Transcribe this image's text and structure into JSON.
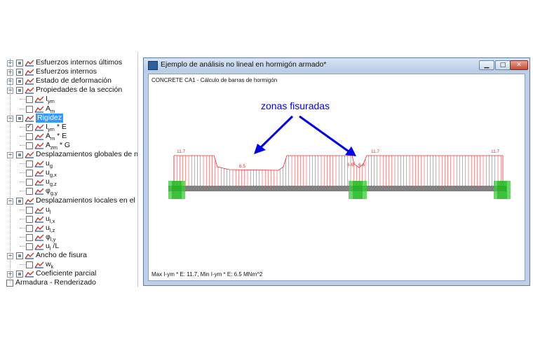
{
  "tree": {
    "items": [
      {
        "label": "Esfuerzos internos últimos",
        "level": 0,
        "sub": ""
      },
      {
        "label": "Esfuerzos internos",
        "level": 0,
        "sub": ""
      },
      {
        "label": "Estado de deformación",
        "level": 0,
        "sub": ""
      },
      {
        "label": "Propiedades de la sección",
        "level": 0,
        "sub": ""
      },
      {
        "label": "I",
        "level": 1,
        "sub": "ym"
      },
      {
        "label": "A",
        "level": 1,
        "sub": "m"
      },
      {
        "label": "Rigidez",
        "level": 0,
        "sub": "",
        "selected": true
      },
      {
        "label": "I",
        "level": 1,
        "sub": "ym",
        "suffix": " * E",
        "checked": true
      },
      {
        "label": "A",
        "level": 1,
        "sub": "m",
        "suffix": " * E"
      },
      {
        "label": "A",
        "level": 1,
        "sub": "zm",
        "suffix": " * G"
      },
      {
        "label": "Desplazamientos globales de nudos",
        "level": 0,
        "sub": ""
      },
      {
        "label": "u",
        "level": 1,
        "sub": "g"
      },
      {
        "label": "u",
        "level": 1,
        "sub": "g,x"
      },
      {
        "label": "u",
        "level": 1,
        "sub": "g,z"
      },
      {
        "label": "φ",
        "level": 1,
        "sub": "g,y"
      },
      {
        "label": "Desplazamientos locales en el nudo",
        "level": 0,
        "sub": ""
      },
      {
        "label": "u",
        "level": 1,
        "sub": "l"
      },
      {
        "label": "u",
        "level": 1,
        "sub": "l,x"
      },
      {
        "label": "u",
        "level": 1,
        "sub": "l,z"
      },
      {
        "label": "φ",
        "level": 1,
        "sub": "l,y"
      },
      {
        "label": "u",
        "level": 1,
        "sub": "l",
        "suffix": " /L"
      },
      {
        "label": "Ancho de fisura",
        "level": 0,
        "sub": ""
      },
      {
        "label": "w",
        "level": 1,
        "sub": "k"
      },
      {
        "label": "Coeficiente parcial",
        "level": 0,
        "sub": ""
      },
      {
        "label": "Armadura - Renderizado",
        "level": -1,
        "sub": ""
      }
    ]
  },
  "window": {
    "title": "Ejemplo de análisis no lineal en hormigón armado*",
    "caption": "CONCRETE CA1 - Cálculo de barras de hormigón",
    "status": "Max I-ym * E: 11.7, Min I-ym * E: 6.5 MNm^2",
    "annotation": "zonas fisuradas",
    "buttons": {
      "minimize": "▁",
      "maximize": "□",
      "close": "✕"
    }
  },
  "diagram": {
    "labels": {
      "left_max": "11.7",
      "mid_min": "6.5",
      "support_left": "6.6",
      "support_right": "6.6",
      "right_start": "11.7",
      "right_end": "11.7"
    },
    "colors": {
      "stiffness": "#e03030",
      "beam": "#808080",
      "support": "#33cc33",
      "arrow": "#0000ee"
    }
  }
}
